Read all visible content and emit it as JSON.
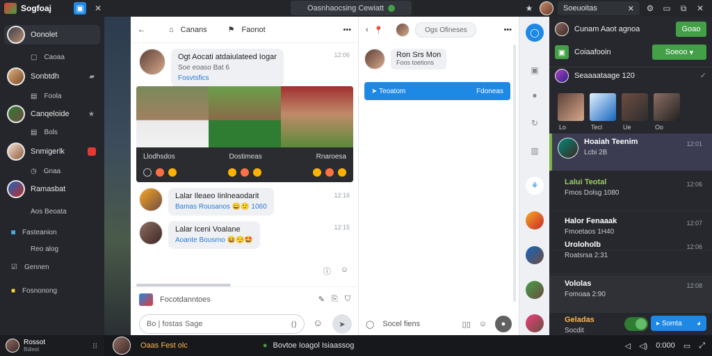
{
  "topbar": {
    "app_name": "Sogfoaj",
    "center_title": "Oasnhaocsing Cewiatt",
    "user_pill": "Soeuoitas"
  },
  "sidebar": {
    "items": [
      {
        "label": "Oonolet"
      },
      {
        "label": "Sonbtdh"
      },
      {
        "label": "Canqeloide"
      },
      {
        "label": "Snmigerlk"
      },
      {
        "label": "Ramasbat"
      }
    ],
    "subs": [
      "Caoaa",
      "Foola",
      "Bols",
      "Gnaa",
      "Aos Beoata",
      "Fasteanion",
      "Reo alog",
      "Gennen",
      "Fosnonong"
    ],
    "bottom_user": {
      "name": "Rossot",
      "sub": "Bdiest"
    }
  },
  "main": {
    "header": {
      "title": "Canans",
      "secondary": "Faonot"
    },
    "messages": [
      {
        "title": "Ogt Aocati atdaiulateed Iogar",
        "sub": "Soe eoaso Bat 6",
        "sub2": "Fosvtsfics",
        "time": "12:06"
      },
      {
        "title": "Lalar Ileaeo Iinlneaodarit",
        "sub": "Bamas Rousanos",
        "sub2": "1060",
        "time": "12:16"
      },
      {
        "title": "Lalar Iceni Voalane",
        "sub": "Aoante Bousrno",
        "sub2": "",
        "time": "12:15"
      }
    ],
    "photo": {
      "left_label": "Llodhsdos",
      "mid_label": "Dostimeas",
      "right_label": "Rnaroesa"
    },
    "composer_label": "Focotdanntoes",
    "input_placeholder": "Bo | fostas Sage"
  },
  "pane2": {
    "search": "Ogs Ofineses",
    "user": {
      "name": "Ron Srs Mon",
      "sub": "Foos toetions"
    },
    "bar_left": "Teoatom",
    "bar_right": "Fdoneas",
    "bottom_label": "Socel fiens"
  },
  "rpanel": {
    "header_name": "Cunam Aaot agnoa",
    "header_btn": "Goao",
    "row2_label": "Coiaafooin",
    "row2_btn": "Soeoo",
    "group_title": "Seaaaataage 120",
    "thumbs": [
      "Lo",
      "Tecl",
      "Ue",
      "Oo"
    ],
    "contacts": [
      {
        "name": "Hoaiah Teenim",
        "sub": "Lcbi 2B",
        "time": "12:01"
      },
      {
        "name": "Lalui Teotal",
        "sub": "Fmos Dolsg 1080",
        "time": "12:06"
      },
      {
        "name": "Halor Fenaaak",
        "sub": "Fmoetaos 1H40",
        "time": "12:07"
      },
      {
        "name": "Uroloholb",
        "sub": "Roatsrsa 2:31",
        "time": "12:06"
      },
      {
        "name": "Vololas",
        "sub": "Fomoaa 2:90",
        "time": "12:08"
      },
      {
        "name": "Geladas",
        "sub": "Socdit",
        "time": ""
      }
    ],
    "call_label": "Somta"
  },
  "statusbar": {
    "left_name": "Oaas Fest olc",
    "center_text": "Bovtoe Ioagol Isiaassog",
    "time": "0:000"
  },
  "colors": {
    "accent_blue": "#1e88e5",
    "accent_green": "#43a047",
    "dark_bg": "#24262b"
  }
}
